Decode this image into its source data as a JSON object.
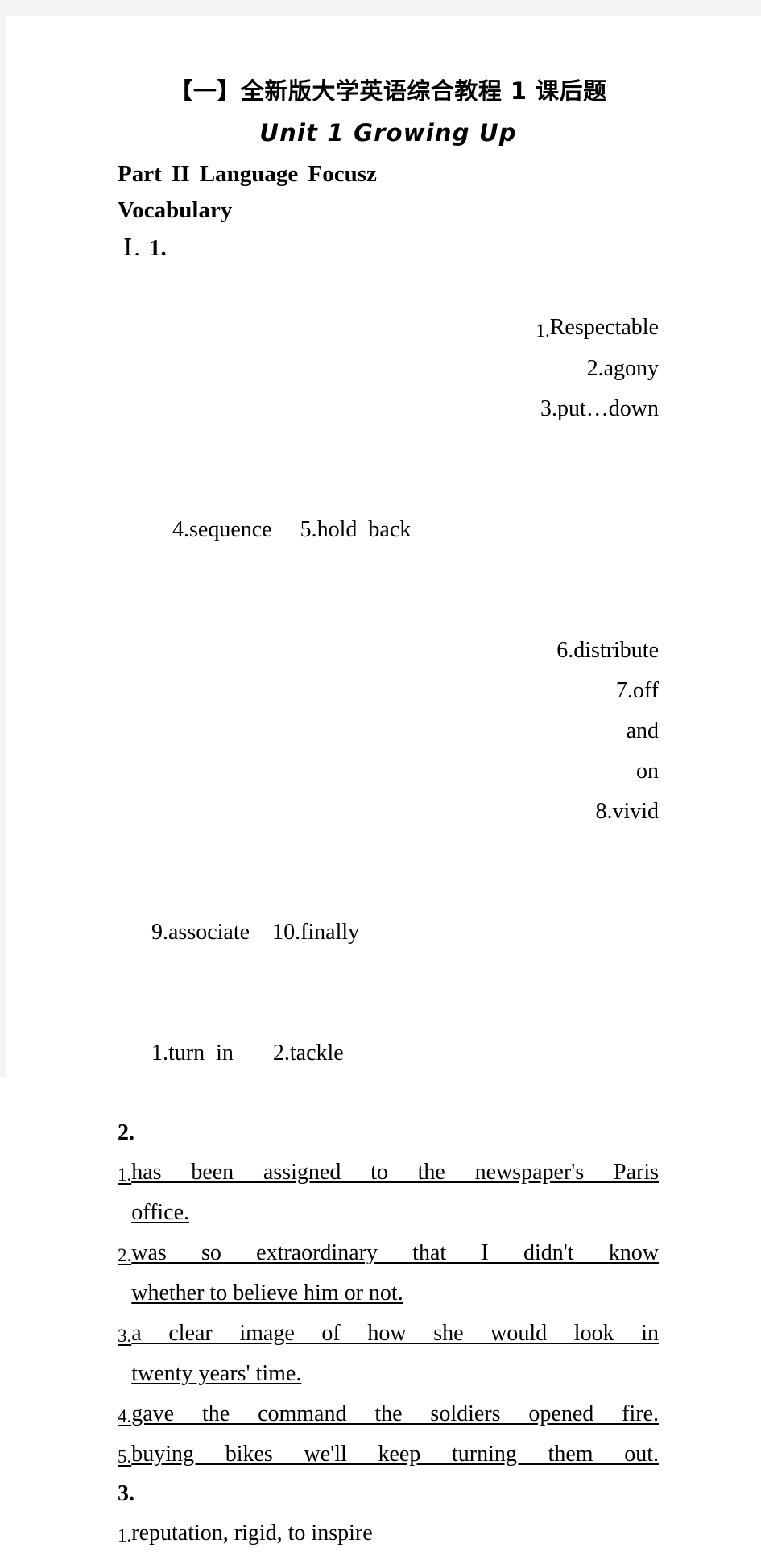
{
  "document": {
    "title_cn": "【一】全新版大学英语综合教程 1 课后题",
    "unit_title": "Unit 1 Growing Up",
    "part_heading": "Part II Language Focusz",
    "section_heading": "Vocabulary"
  },
  "exercise_1": {
    "roman": "Ⅰ",
    "separator": ". ",
    "number": "1.",
    "lines": [
      "1.Respectable 2.agony 3.put…down",
      "4.sequence 5.hold back",
      "6.distribute 7.off and on 8.vivid",
      "9.associate 10.finally",
      "1.turn in 2.tackle"
    ],
    "rows": [
      {
        "marker": "1.",
        "text": "Respectable            2.agony               3.put…down"
      },
      {
        "marker": "",
        "text": "4.sequence     5.hold  back"
      },
      {
        "marker": "",
        "text": "6.distribute          7.off     and     on          8.vivid"
      },
      {
        "marker": "",
        "text": "9.associate     10.finally"
      },
      {
        "marker": "",
        "text": "1.turn  in          2.tackle"
      }
    ]
  },
  "exercise_2": {
    "number": "2.",
    "items": [
      {
        "marker": "1.",
        "text": "has been assigned to the newspaper's Paris office."
      },
      {
        "marker": "2.",
        "text": "was so extraordinary that I didn't know whether to believe him or not."
      },
      {
        "marker": "3.",
        "text": "a clear image of how she would look in twenty years' time."
      },
      {
        "marker": "4.",
        "text": "gave the command the soldiers opened fire."
      },
      {
        "marker": "5.",
        "text": "buying bikes we'll keep turning them out."
      }
    ]
  },
  "exercise_3": {
    "number": "3.",
    "items": [
      {
        "marker": "1.",
        "text": "reputation,  rigid,  to  inspire"
      }
    ]
  },
  "line_fragments": {
    "l1_a": "1.",
    "l1_b": "Respectable",
    "l1_c": "2.agony",
    "l1_d": "3.put…down",
    "l2_a": "4.sequence",
    "l2_b": "5.hold  back",
    "l3_a": "6.distribute",
    "l3_b": "7.off",
    "l3_c": "and",
    "l3_d": "on",
    "l3_e": "8.vivid",
    "l4_a": "9.associate",
    "l4_b": "10.finally",
    "l5_a": "1.turn  in",
    "l5_b": "2.tackle",
    "i2_1_a": "has  been  assigned  to  the  newspaper's  Paris",
    "i2_1_b": "office.",
    "i2_2_a": "was  so  extraordinary  that  I  didn't  know",
    "i2_2_b": "whether  to  believe  him  or  not.",
    "i2_3_a": "a  clear  image  of  how  she  would  look  in",
    "i2_3_b": "twenty  years'  time.",
    "i2_4_a": "gave  the  command  the  soldiers  opened  fire.",
    "i2_5_a": "buying  bikes  we'll  keep  turning  them  out.",
    "i3_1_a": "reputation,  rigid,  to  inspire",
    "m1": "1.",
    "m2": "2.",
    "m3": "3.",
    "m4": "4.",
    "m5": "5."
  }
}
